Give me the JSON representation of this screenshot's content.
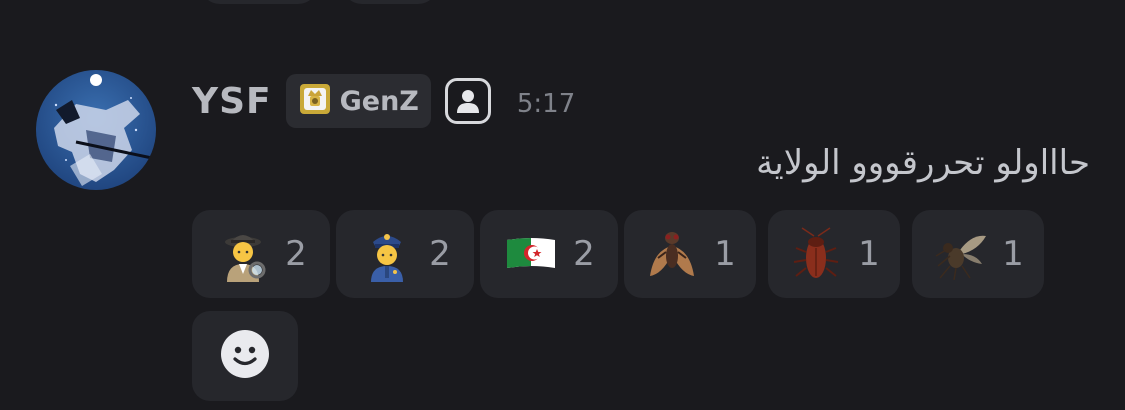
{
  "message": {
    "username": "YSF",
    "tag_label": "GenZ",
    "timestamp": "5:17",
    "text": "حاااولو تحررقووو الولاية"
  },
  "reactions": [
    {
      "emoji": "detective-emoji",
      "count": "2"
    },
    {
      "emoji": "police-officer-emoji",
      "count": "2"
    },
    {
      "emoji": "algeria-flag-emoji",
      "count": "2"
    },
    {
      "emoji": "fly-emoji",
      "count": "1"
    },
    {
      "emoji": "cockroach-emoji",
      "count": "1"
    },
    {
      "emoji": "mosquito-emoji",
      "count": "1"
    }
  ],
  "icons": {
    "tag_icon": "tag-badge-icon",
    "profile_badge": "person-icon",
    "add_reaction": "smiley-icon"
  },
  "colors": {
    "background": "#1a1a1e",
    "surface": "#26272c",
    "username": "#b7b9bf",
    "timestamp": "#7f828a"
  }
}
